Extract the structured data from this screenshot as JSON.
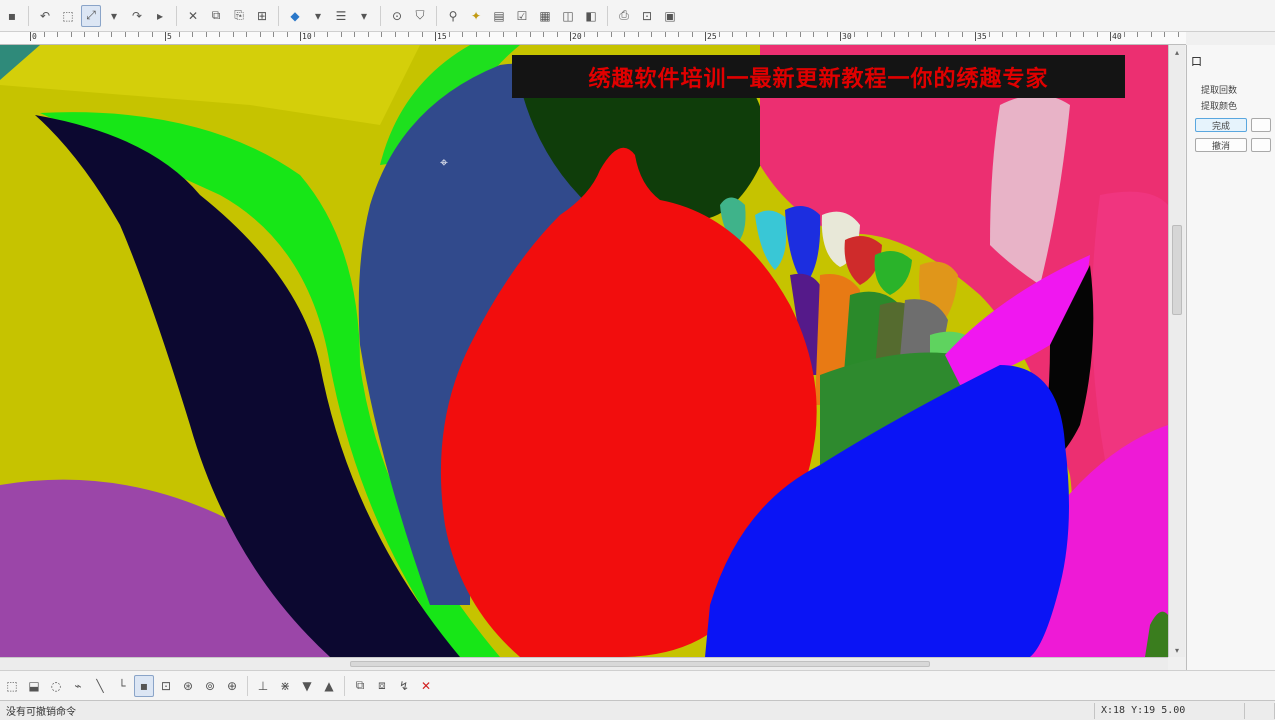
{
  "banner_text": "绣趣软件培训一最新更新教程一你的绣趣专家",
  "ruler_labels": [
    "0",
    "5",
    "10",
    "15",
    "20",
    "25",
    "30",
    "35",
    "40"
  ],
  "right_panel": {
    "title": "口",
    "rows": [
      "提取回数",
      "提取颜色"
    ],
    "buttons": [
      "完成",
      "撤消"
    ]
  },
  "status": {
    "message": "没有可撤销命令",
    "coordinates": "X:18 Y:19 5.00"
  },
  "toolbar_top_icons": [
    "save-icon",
    "undo-icon",
    "redo-icon",
    "select-icon",
    "move-icon",
    "cut-icon",
    "copy-icon",
    "paste-icon",
    "delete-icon",
    "fill-icon",
    "stitch-icon",
    "needle-icon",
    "zoom-icon",
    "frame-icon",
    "pin-icon",
    "bulb-icon",
    "fabric-icon",
    "check-icon",
    "grid-icon",
    "hoop-icon",
    "color-icon",
    "print-icon"
  ],
  "toolbar_bottom_icons": [
    "rect-select-icon",
    "freehand-select-icon",
    "lasso-icon",
    "magic-wand-icon",
    "line-icon",
    "point-icon",
    "node-icon",
    "bezier-icon",
    "rotate-icon",
    "mirror-icon",
    "align-icon",
    "distribute-icon",
    "arrow-down-icon",
    "arrow-up-icon",
    "group-icon",
    "ungroup-icon",
    "break-icon",
    "close-icon"
  ],
  "colors": {
    "canvas_bg": "#c9c500",
    "banner_text": "#e00000",
    "banner_bg": "#141414"
  }
}
